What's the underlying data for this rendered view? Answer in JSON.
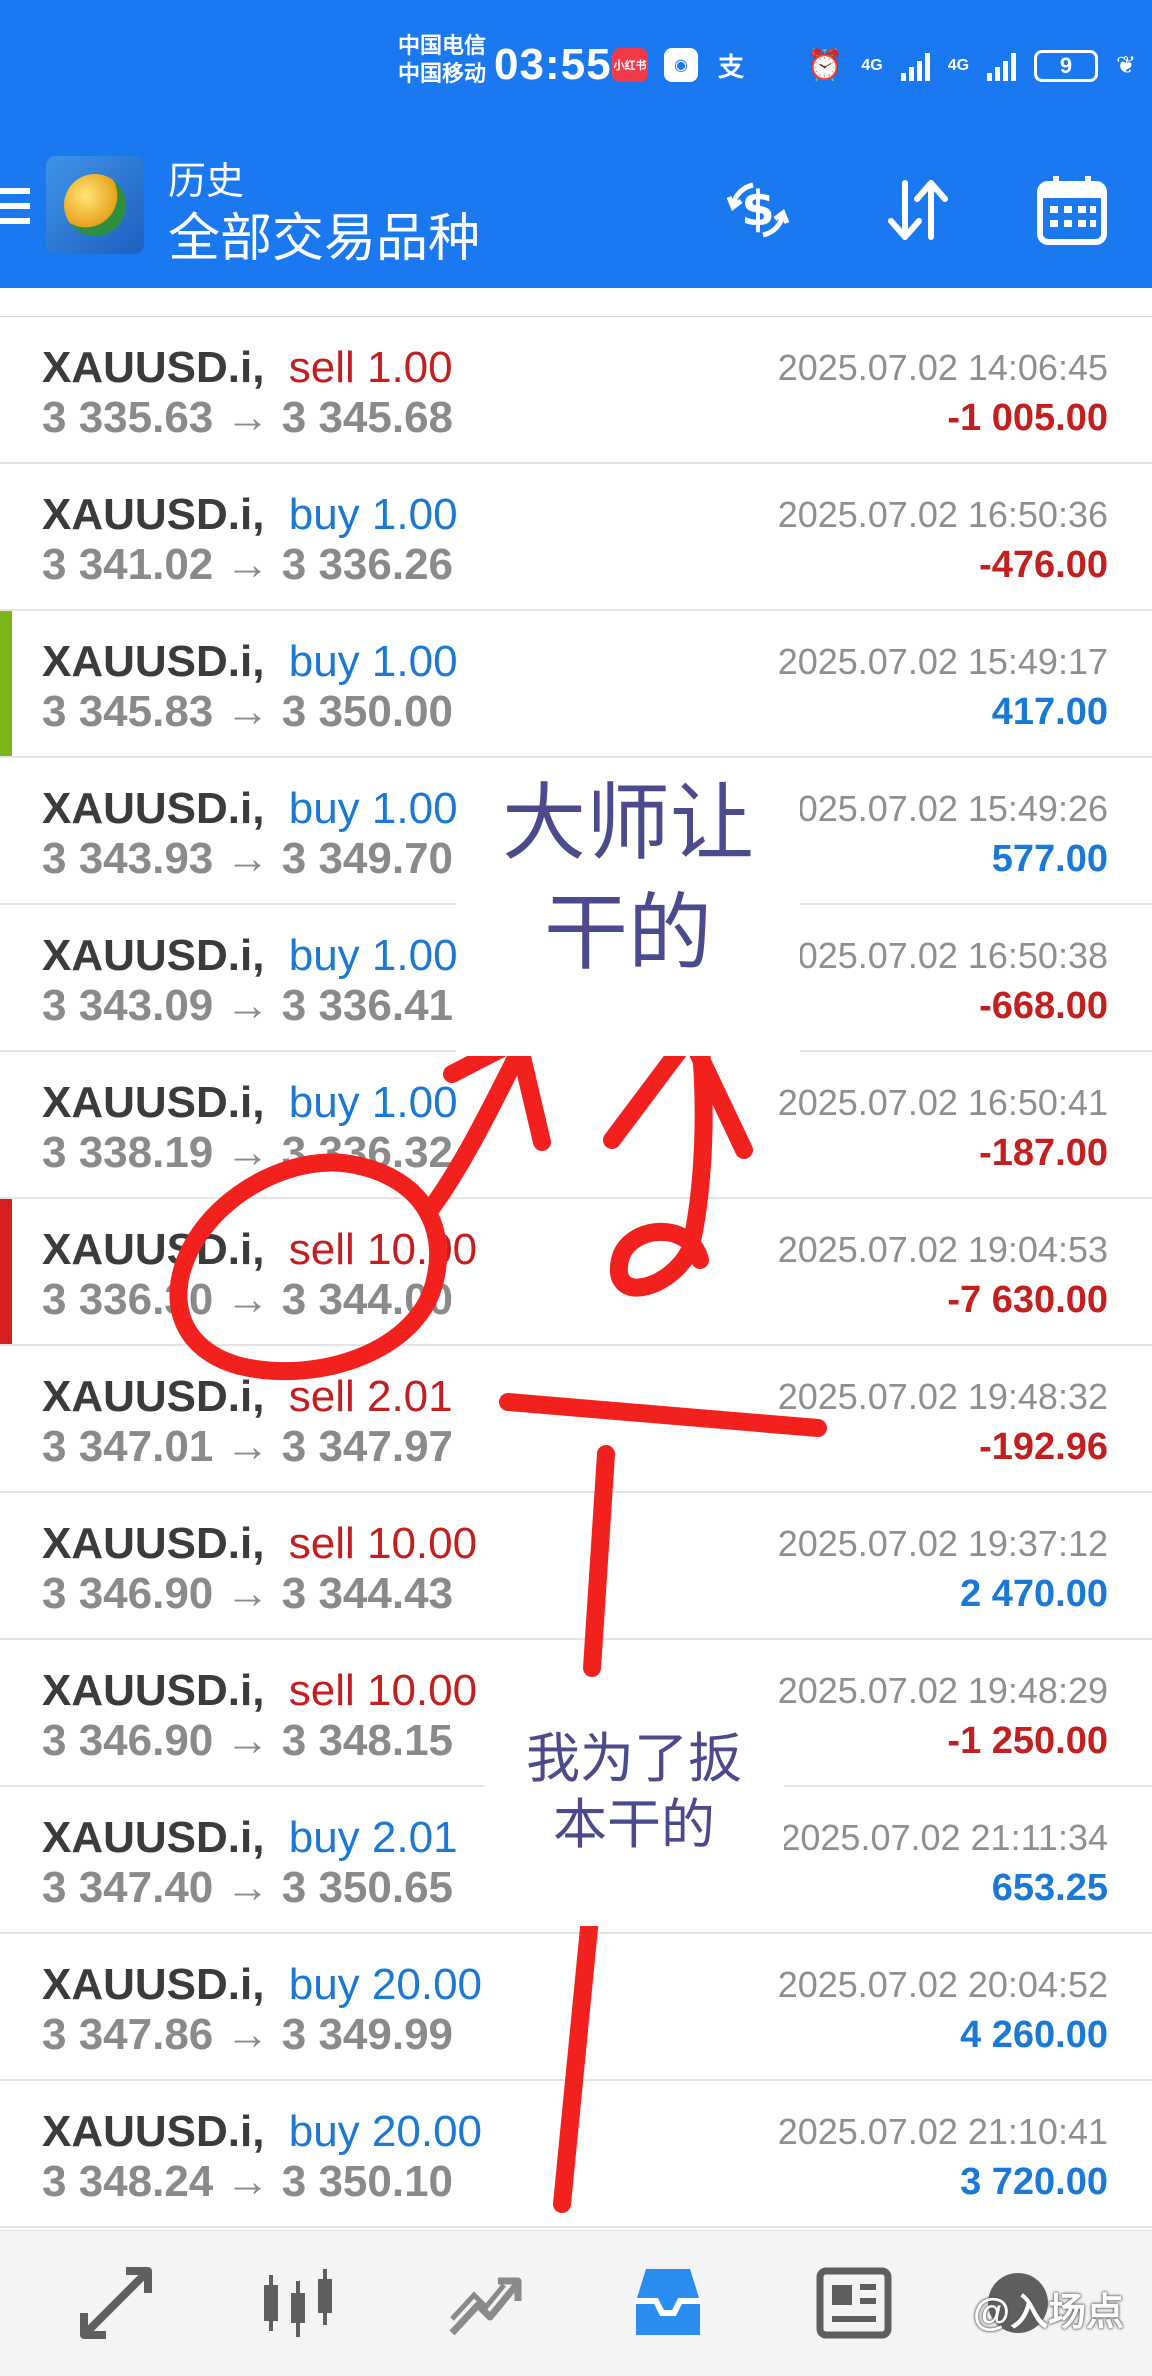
{
  "status_bar": {
    "carrier_1": "中国电信",
    "carrier_2": "中国移动",
    "time": "03:55",
    "app_icon_1": "小红书",
    "battery": "9",
    "net_1": "4G",
    "net_2": "4G"
  },
  "header": {
    "section": "历史",
    "filter": "全部交易品种",
    "actions": [
      "dollar-sync-icon",
      "sort-icon",
      "calendar-icon"
    ],
    "color": "#1a79f0"
  },
  "trades": [
    {
      "symbol": "XAUUSD.i",
      "type": "sell",
      "volume": "1.00",
      "open": "3 335.63",
      "close": "3 345.68",
      "time": "2025.07.02 14:06:45",
      "profit": "-1 005.00"
    },
    {
      "symbol": "XAUUSD.i",
      "type": "buy",
      "volume": "1.00",
      "open": "3 341.02",
      "close": "3 336.26",
      "time": "2025.07.02 16:50:36",
      "profit": "-476.00"
    },
    {
      "symbol": "XAUUSD.i",
      "type": "buy",
      "volume": "1.00",
      "open": "3 345.83",
      "close": "3 350.00",
      "time": "2025.07.02 15:49:17",
      "profit": "417.00",
      "marker": "#7cb518"
    },
    {
      "symbol": "XAUUSD.i",
      "type": "buy",
      "volume": "1.00",
      "open": "3 343.93",
      "close": "3 349.70",
      "time": "2025.07.02 15:49:26",
      "profit": "577.00"
    },
    {
      "symbol": "XAUUSD.i",
      "type": "buy",
      "volume": "1.00",
      "open": "3 343.09",
      "close": "3 336.41",
      "time": "2025.07.02 16:50:38",
      "profit": "-668.00"
    },
    {
      "symbol": "XAUUSD.i",
      "type": "buy",
      "volume": "1.00",
      "open": "3 338.19",
      "close": "3 336.32",
      "time": "2025.07.02 16:50:41",
      "profit": "-187.00"
    },
    {
      "symbol": "XAUUSD.i",
      "type": "sell",
      "volume": "10.00",
      "open": "3 336.30",
      "close": "3 344.00",
      "time": "2025.07.02 19:04:53",
      "profit": "-7 630.00",
      "marker": "#d81f1f"
    },
    {
      "symbol": "XAUUSD.i",
      "type": "sell",
      "volume": "2.01",
      "open": "3 347.01",
      "close": "3 347.97",
      "time": "2025.07.02 19:48:32",
      "profit": "-192.96"
    },
    {
      "symbol": "XAUUSD.i",
      "type": "sell",
      "volume": "10.00",
      "open": "3 346.90",
      "close": "3 344.43",
      "time": "2025.07.02 19:37:12",
      "profit": "2 470.00"
    },
    {
      "symbol": "XAUUSD.i",
      "type": "sell",
      "volume": "10.00",
      "open": "3 346.90",
      "close": "3 348.15",
      "time": "2025.07.02 19:48:29",
      "profit": "-1 250.00"
    },
    {
      "symbol": "XAUUSD.i",
      "type": "buy",
      "volume": "2.01",
      "open": "3 347.40",
      "close": "3 350.65",
      "time": "2025.07.02 21:11:34",
      "profit": "653.25"
    },
    {
      "symbol": "XAUUSD.i",
      "type": "buy",
      "volume": "20.00",
      "open": "3 347.86",
      "close": "3 349.99",
      "time": "2025.07.02 20:04:52",
      "profit": "4 260.00"
    },
    {
      "symbol": "XAUUSD.i",
      "type": "buy",
      "volume": "20.00",
      "open": "3 348.24",
      "close": "3 350.10",
      "time": "2025.07.02 21:10:41",
      "profit": "3 720.00"
    }
  ],
  "annotations": {
    "note_1_line_1": "大师让",
    "note_1_line_2": "干的",
    "note_2_line_1": "我为了扳",
    "note_2_line_2": "本干的",
    "ink_color": "#f2211e"
  },
  "bottom_nav": {
    "items": [
      "quotes-icon",
      "chart-icon",
      "trade-icon",
      "history-icon",
      "news-icon",
      "settings-icon"
    ],
    "active": "history-icon",
    "watermark": "@入场点"
  },
  "colors": {
    "sell": "#c41f1f",
    "buy": "#1a79d6",
    "loss": "#c41f1f",
    "profit": "#1a79d6"
  }
}
